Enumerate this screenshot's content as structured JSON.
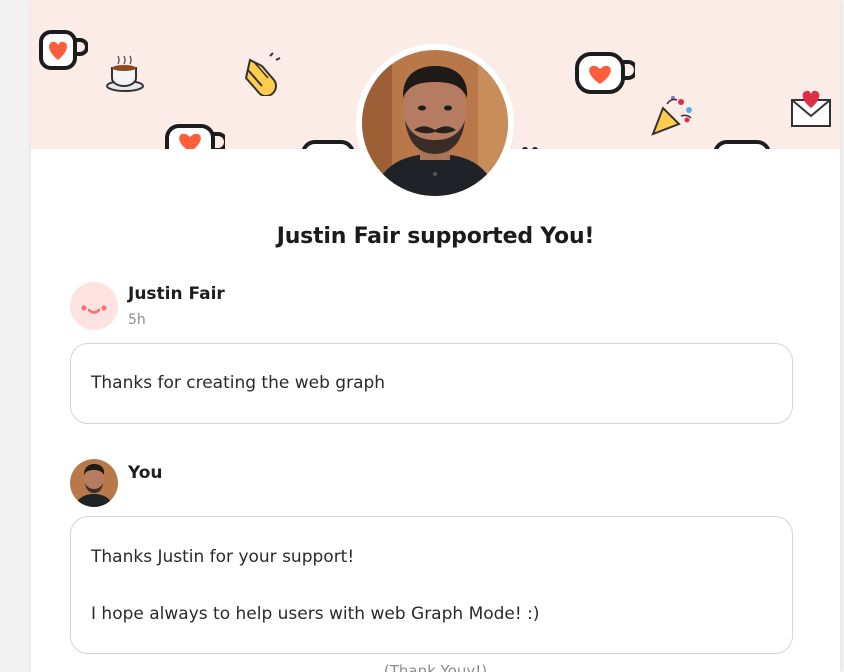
{
  "headline": "Justin Fair supported You!",
  "supporter": {
    "name": "Justin Fair",
    "time": "5h",
    "message": "Thanks for creating the web graph"
  },
  "reply": {
    "name": "You",
    "line1": "Thanks Justin for your support!",
    "line2": "I hope always to help users with web Graph Mode! :)"
  },
  "footer": "(Thank Youy!)",
  "colors": {
    "banner": "#fcece8",
    "accent": "#ff5e3a",
    "avatar_pink": "#fde2e2"
  },
  "decorations": [
    "coffee-cup-heart-icon",
    "hot-drink-icon",
    "clapping-hands-icon",
    "party-popper-icon",
    "love-letter-icon"
  ]
}
